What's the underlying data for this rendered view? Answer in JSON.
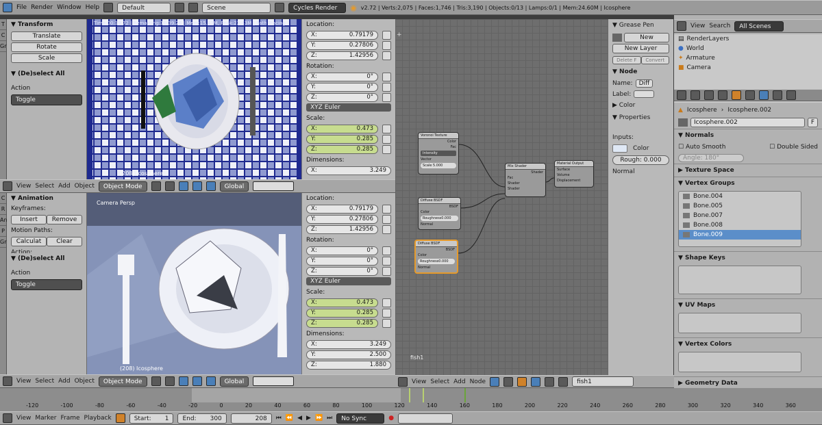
{
  "topbar": {
    "menus": [
      "File",
      "Render",
      "Window",
      "Help"
    ],
    "layout": "Default",
    "scene": "Scene",
    "engine": "Cycles Render",
    "status": "v2.72 | Verts:2,075 | Faces:1,746 | Tris:3,190 | Objects:0/13 | Lamps:0/1 | Mem:24.60M | Icosphere"
  },
  "toolshelf_top": {
    "header": "▼ Transform",
    "buttons": [
      "Translate",
      "Rotate",
      "Scale"
    ],
    "deselect": "▼ (De)select All",
    "action_label": "Action",
    "action_value": "Toggle",
    "tabs": [
      "T",
      "C",
      "Gr"
    ]
  },
  "viewport_top": {
    "overlay": "Time:00:19.72 | Remaining:10:39.26 | Mem:15.43M, Peak:22.43M | Path Tracing",
    "footer": "(208) Icosphere"
  },
  "viewport_top_header": {
    "items": [
      "View",
      "Select",
      "Add",
      "Object"
    ],
    "mode": "Object Mode",
    "orientation": "Global"
  },
  "toolshelf_bot": {
    "header": "▼ Animation",
    "keyframes_label": "Keyframes:",
    "insert": "Insert",
    "remove": "Remove",
    "motion_label": "Motion Paths:",
    "calculate": "Calculat",
    "clear": "Clear",
    "action_cut": "Action:",
    "deselect": "▼ (De)select All",
    "action_label": "Action",
    "action_value": "Toggle",
    "tabs": [
      "C",
      "R",
      "An",
      "P",
      "Gre"
    ]
  },
  "viewport_bot": {
    "label": "Camera Persp",
    "footer": "(208) Icosphere"
  },
  "viewport_bot_header": {
    "items": [
      "View",
      "Select",
      "Add",
      "Object"
    ],
    "mode": "Object Mode",
    "orientation": "Global"
  },
  "props_top": {
    "location_label": "Location:",
    "loc": [
      [
        "X:",
        "0.79179"
      ],
      [
        "Y:",
        "0.27806"
      ],
      [
        "Z:",
        "1.42956"
      ]
    ],
    "rotation_label": "Rotation:",
    "rot": [
      [
        "X:",
        "0°"
      ],
      [
        "Y:",
        "0°"
      ],
      [
        "Z:",
        "0°"
      ]
    ],
    "euler": "XYZ Euler",
    "scale_label": "Scale:",
    "scale": [
      [
        "X:",
        "0.473"
      ],
      [
        "Y:",
        "0.285"
      ],
      [
        "Z:",
        "0.285"
      ]
    ],
    "dimensions_label": "Dimensions:",
    "dim": [
      [
        "X:",
        "3.249"
      ]
    ]
  },
  "props_bot": {
    "location_label": "Location:",
    "loc": [
      [
        "X:",
        "0.79179"
      ],
      [
        "Y:",
        "0.27806"
      ],
      [
        "Z:",
        "1.42956"
      ]
    ],
    "rotation_label": "Rotation:",
    "rot": [
      [
        "X:",
        "0°"
      ],
      [
        "Y:",
        "0°"
      ],
      [
        "Z:",
        "0°"
      ]
    ],
    "euler": "XYZ Euler",
    "scale_label": "Scale:",
    "scale": [
      [
        "X:",
        "0.473"
      ],
      [
        "Y:",
        "0.285"
      ],
      [
        "Z:",
        "0.285"
      ]
    ],
    "dimensions_label": "Dimensions:",
    "dim": [
      [
        "X:",
        "3.249"
      ],
      [
        "Y:",
        "2.500"
      ],
      [
        "Z:",
        "1.880"
      ]
    ]
  },
  "node_editor": {
    "material": "fish1",
    "nodes": {
      "voronoi": {
        "title": "Voronoi Texture",
        "out1": "Color",
        "out2": "Fac",
        "mode": "Intensity",
        "vector": "Vector",
        "scale": "Scale  5.000"
      },
      "diffuse1": {
        "title": "Diffuse BSDF",
        "out": "BSDF",
        "color": "Color",
        "rough": "Roughness0.000",
        "normal": "Normal"
      },
      "diffuse2": {
        "title": "Diffuse BSDF",
        "out": "BSDF",
        "color": "Color",
        "rough": "Roughness0.000",
        "normal": "Normal"
      },
      "mix": {
        "title": "Mix Shader",
        "out": "Shader",
        "fac": "Fac",
        "s1": "Shader",
        "s2": "Shader"
      },
      "output": {
        "title": "Material Output",
        "surface": "Surface",
        "volume": "Volume",
        "disp": "Displacement"
      }
    }
  },
  "node_header": {
    "items": [
      "View",
      "Select",
      "Add",
      "Node"
    ],
    "material": "fish1"
  },
  "node_npanel": {
    "grease": "▼ Grease Pen",
    "new": "New",
    "new_layer": "New Layer",
    "delete": "Delete F",
    "convert": "Convert",
    "node_sec": "▼ Node",
    "name_label": "Name:",
    "name_value": "Diff",
    "label_label": "Label:",
    "color_sec": "▶ Color",
    "properties_sec": "▼ Properties",
    "inputs_label": "Inputs:",
    "color_label": "Color",
    "rough": "Rough: 0.000",
    "normal": "Normal"
  },
  "outliner": {
    "view": "View",
    "search": "Search",
    "filter": "All Scenes",
    "items": [
      "RenderLayers",
      "World",
      "Armature",
      "Camera"
    ]
  },
  "properties": {
    "breadcrumb1": "Icosphere",
    "breadcrumb2": "Icosphere.002",
    "mesh_name": "Icosphere.002",
    "mesh_f": "F",
    "normals": "▼ Normals",
    "auto_smooth": "Auto Smooth",
    "double_sided": "Double Sided",
    "angle": "Angle:    180°",
    "texture_space": "▶ Texture Space",
    "vertex_groups": "▼ Vertex Groups",
    "groups": [
      "Bone.004",
      "Bone.005",
      "Bone.007",
      "Bone.008",
      "Bone.009"
    ],
    "selected_group": 4,
    "shape_keys": "▼ Shape Keys",
    "uv_maps": "▼ UV Maps",
    "vertex_colors": "▼ Vertex Colors",
    "geometry_data": "▶ Geometry Data"
  },
  "timeline": {
    "ticks": [
      "-120",
      "-100",
      "-80",
      "-60",
      "-40",
      "-20",
      "0",
      "20",
      "40",
      "60",
      "80",
      "100",
      "120",
      "140",
      "160",
      "180",
      "200",
      "220",
      "240",
      "260",
      "280",
      "300",
      "320",
      "340",
      "360"
    ]
  },
  "bottombar": {
    "items": [
      "View",
      "Marker",
      "Frame",
      "Playback"
    ],
    "start": "Start:",
    "start_val": "1",
    "end": "End:",
    "end_val": "300",
    "frame": "208",
    "sync": "No Sync"
  },
  "colors": {
    "accent": "#e69a2a",
    "selected": "#5b8ec9",
    "green_field": "#c7dc8f",
    "tablecloth": "#1f2a8f"
  }
}
